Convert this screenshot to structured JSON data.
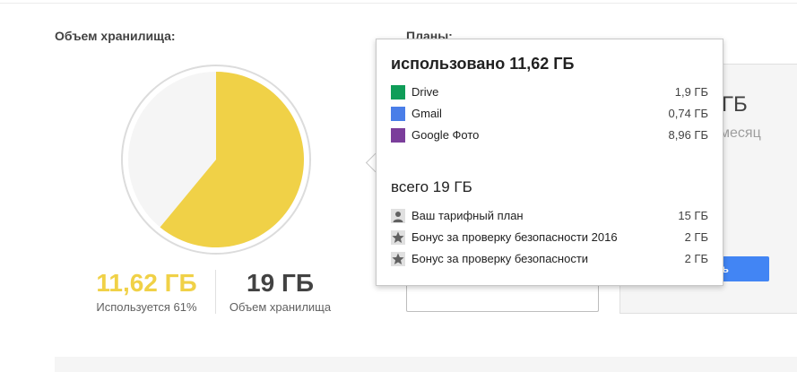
{
  "storage": {
    "title": "Объем хранилища:",
    "used_value": "11,62 ГБ",
    "used_caption": "Используется 61%",
    "total_value": "19 ГБ",
    "total_caption": "Объем хранилища",
    "used_fraction": 0.61,
    "colors": {
      "used": "#f0d147",
      "free": "#f5f5f5"
    }
  },
  "plans": {
    "title": "Планы:",
    "card_size": "ГБ",
    "card_period": "месяц",
    "card_button": "ать"
  },
  "popup": {
    "used_heading": "использовано 11,62 ГБ",
    "usage": [
      {
        "label": "Drive",
        "value": "1,9 ГБ",
        "color": "#0f9d58"
      },
      {
        "label": "Gmail",
        "value": "0,74 ГБ",
        "color": "#4a7ee8"
      },
      {
        "label": "Google Фото",
        "value": "8,96 ГБ",
        "color": "#7b3e9b"
      }
    ],
    "total_heading": "всего 19 ГБ",
    "breakdown": [
      {
        "label": "Ваш тарифный план",
        "value": "15 ГБ",
        "icon": "person-icon"
      },
      {
        "label": "Бонус за проверку безопасности 2016",
        "value": "2 ГБ",
        "icon": "star-icon"
      },
      {
        "label": "Бонус за проверку безопасности",
        "value": "2 ГБ",
        "icon": "star-icon"
      }
    ]
  }
}
